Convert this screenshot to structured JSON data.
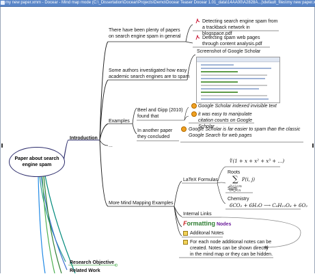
{
  "window": {
    "title": "my new paper.xmm - Docear - Mind map mode (C:\\_Dissertation\\Docear\\Projects\\Demo\\Docear Teaser Docear 1.01_data\\14AA00\\A2828A...)\\default_files\\my new paper.xmm"
  },
  "map": {
    "root": "Paper about search engine spam",
    "introduction": "Introduction",
    "intro_node_1": "There have been plenty of papers on search engine spam in general",
    "pdf_1": "Detecting search engine spam from a trackback network in blogspace.pdf",
    "pdf_2": "Detecting spam web pages through content analysis.pdf",
    "intro_node_2": "Some authors investigated how easy academic search engines are to spam",
    "screenshot_label": "Screenshot of Google Scholar",
    "examples": "Examples",
    "example_1_lead": "Beel and Gipp (2010) found that",
    "example_1_note_a": "Google Scholar indexed invisible text",
    "example_1_note_b": "it was easy to manipulate citation counts on Google Scholar",
    "example_2_lead": "In another paper they concluded",
    "example_2_note": "Google Scholar is far easier to spam than the classic Google Search for web pages",
    "ellipsis": "...",
    "more_examples": "More Mind Mapping Examples",
    "latex": "LaTeX Formulas",
    "roots": "Roots",
    "sum": "Sum",
    "chemistry": "Chemistry",
    "internal_links": "Internal Links",
    "formatting_nodes": "Formatting Nodes",
    "additional_notes": "Additonal Notes",
    "notes_text": "For each node additional notes can be created. Notes can be shown directly in the mind map or they can be hidden.",
    "research_objective": "Research Objective",
    "related_work": "Related Work"
  },
  "colors": {
    "titlebar": "#5a86c8",
    "pdf_icon": "#c8102e",
    "smiley": "#f0a020",
    "line_green": "#4caf50",
    "line_blue": "#3b6fd1",
    "line_teal": "#2a9d8f"
  },
  "icons": [
    "pdf-icon",
    "smiley-icon",
    "note-icon"
  ]
}
